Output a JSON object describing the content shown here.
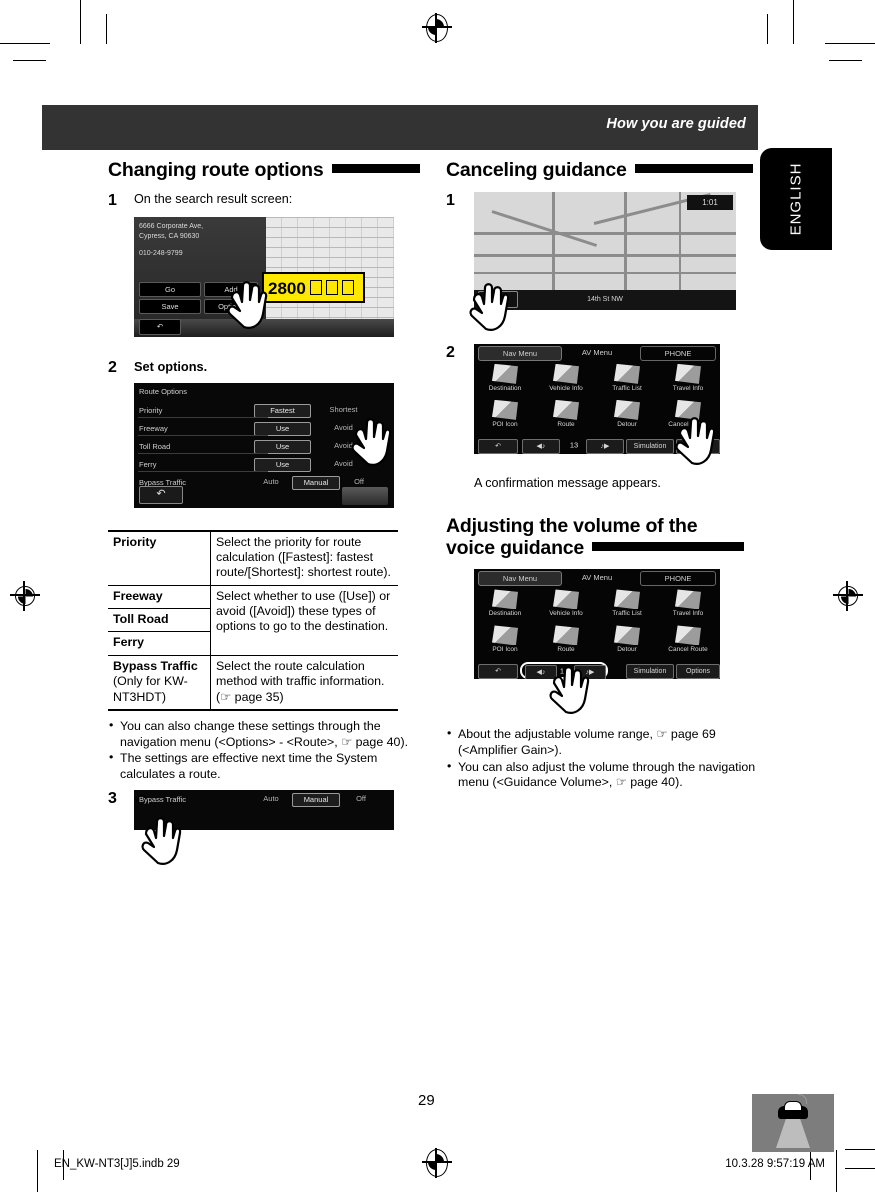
{
  "header": {
    "running_title": "How you are guided",
    "language_tab": "ENGLISH"
  },
  "left_column": {
    "section_title": "Changing route options",
    "steps": [
      {
        "num": "1",
        "text": "On the search result screen:"
      },
      {
        "num": "2",
        "text": "Set options."
      },
      {
        "num": "3",
        "text": ""
      }
    ],
    "search_screen": {
      "address_line1": "6666 Corporate Ave,",
      "address_line2": "Cypress, CA 90630",
      "phone": "010-248-9799",
      "buttons": [
        "Go",
        "Save",
        "Add",
        "Options"
      ],
      "callout_value": "2800",
      "back_icon": "back-arrow-icon"
    },
    "route_options_screen": {
      "title": "Route Options",
      "rows": [
        {
          "label": "Priority",
          "options": [
            "Fastest",
            "Shortest"
          ],
          "selected": "Fastest"
        },
        {
          "label": "Freeway",
          "options": [
            "Use",
            "Avoid"
          ],
          "selected": "Use"
        },
        {
          "label": "Toll Road",
          "options": [
            "Use",
            "Avoid"
          ],
          "selected": "Use"
        },
        {
          "label": "Ferry",
          "options": [
            "Use",
            "Avoid"
          ],
          "selected": "Use"
        },
        {
          "label": "Bypass Traffic",
          "options": [
            "Auto",
            "Manual",
            "Off"
          ],
          "selected": "Manual"
        }
      ]
    },
    "table": {
      "rows": [
        {
          "key": "Priority",
          "key_sub": "",
          "desc": "Select the priority for route calculation ([Fastest]: fastest route/[Shortest]: shortest route)."
        },
        {
          "key": "Freeway",
          "key_sub": "",
          "desc": ""
        },
        {
          "key": "Toll Road",
          "key_sub": "",
          "desc": "Select whether to use ([Use]) or avoid ([Avoid]) these types of options to go to the destination."
        },
        {
          "key": "Ferry",
          "key_sub": "",
          "desc": ""
        },
        {
          "key": "Bypass Traffic",
          "key_sub": "(Only for KW-NT3HDT)",
          "desc": "Select the route calculation method with traffic information. (☞ page 35)"
        }
      ]
    },
    "notes": [
      "You can also change these settings through the navigation menu (<Options> - <Route>, ☞ page 40).",
      "The settings are effective next time the System calculates a route."
    ]
  },
  "right_column": {
    "section1_title": "Canceling guidance",
    "section2_title_line1": "Adjusting the volume of the",
    "section2_title_line2": "voice guidance",
    "steps": [
      {
        "num": "1",
        "text": ""
      },
      {
        "num": "2",
        "text": ""
      }
    ],
    "map_screen": {
      "clock": "1:01",
      "street": "14th St NW",
      "menu_label": "Menu"
    },
    "nav_menu": {
      "tabs": [
        "Nav Menu",
        "AV Menu",
        "PHONE"
      ],
      "cells": [
        "Destination",
        "Vehicle Info",
        "Traffic List",
        "Travel Info",
        "POI Icon",
        "Route",
        "Detour",
        "Cancel Route"
      ],
      "bottom": [
        "Simulation",
        "Options"
      ],
      "volume_value": "13",
      "back_icon": "back-arrow-icon",
      "volume_down_icon": "volume-down-icon",
      "volume_up_icon": "volume-up-icon"
    },
    "confirmation_caption": "A confirmation message appears.",
    "notes": [
      "About the adjustable volume range, ☞ page 69 (<Amplifier Gain>).",
      "You can also adjust the volume through the navigation menu (<Guidance Volume>, ☞ page 40)."
    ]
  },
  "footer": {
    "page_number": "29",
    "file_name": "EN_KW-NT3[J]5.indb   29",
    "timestamp": "10.3.28   9:57:19 AM",
    "car_icon": "car-beam-icon"
  },
  "colors": {
    "header_band": "#333333",
    "callout_yellow": "#ffe800",
    "tab_black": "#000000"
  }
}
